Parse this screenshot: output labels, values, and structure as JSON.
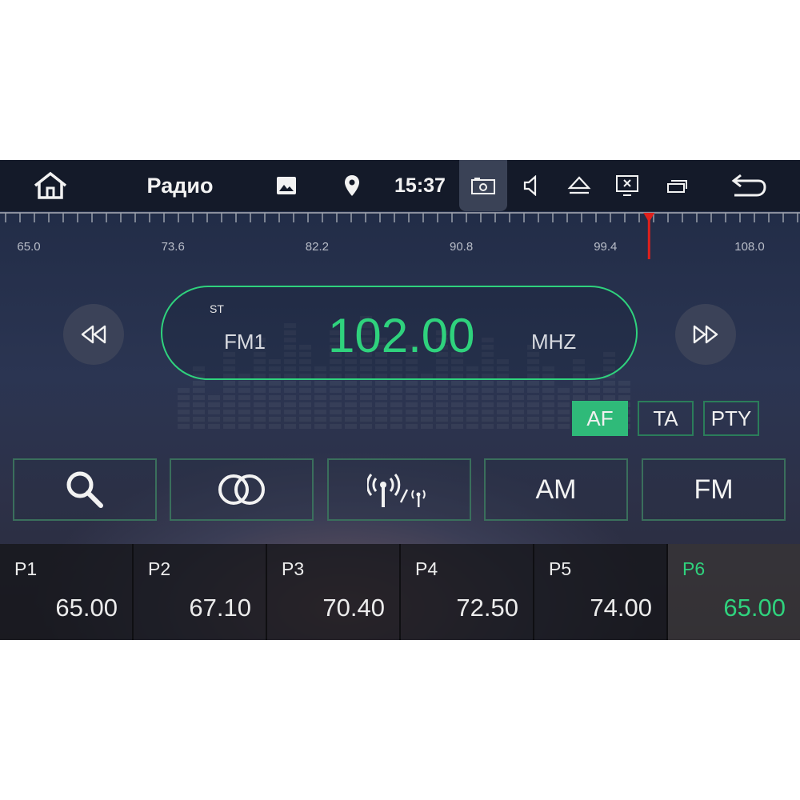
{
  "statusbar": {
    "title": "Радио",
    "clock": "15:37",
    "icons": [
      "home-icon",
      "image-icon",
      "location-pin-icon",
      "camera-icon",
      "volume-icon",
      "eject-icon",
      "close-screen-icon",
      "window-icon",
      "back-icon"
    ]
  },
  "tuner": {
    "scale_labels": [
      "65.0",
      "73.6",
      "82.2",
      "90.8",
      "99.4",
      "108.0"
    ],
    "range": [
      65.0,
      108.0
    ],
    "current": 102.0,
    "stereo": "ST",
    "band": "FM1",
    "frequency": "102.00",
    "unit": "MHZ"
  },
  "options": [
    {
      "label": "AF",
      "active": true
    },
    {
      "label": "TA",
      "active": false
    },
    {
      "label": "PTY",
      "active": false
    }
  ],
  "functions": [
    {
      "name": "search",
      "icon": "search-icon",
      "label": ""
    },
    {
      "name": "stereo",
      "icon": "stereo-icon",
      "label": ""
    },
    {
      "name": "local-distance",
      "icon": "antenna-icon",
      "label": ""
    },
    {
      "name": "am",
      "icon": "",
      "label": "AM"
    },
    {
      "name": "fm",
      "icon": "",
      "label": "FM"
    }
  ],
  "presets": [
    {
      "label": "P1",
      "freq": "65.00",
      "active": false
    },
    {
      "label": "P2",
      "freq": "67.10",
      "active": false
    },
    {
      "label": "P3",
      "freq": "70.40",
      "active": false
    },
    {
      "label": "P4",
      "freq": "72.50",
      "active": false
    },
    {
      "label": "P5",
      "freq": "74.00",
      "active": false
    },
    {
      "label": "P6",
      "freq": "65.00",
      "active": true
    }
  ],
  "colors": {
    "accent": "#2fd27d",
    "needle": "#e0201c",
    "statusbar": "#141a29"
  }
}
